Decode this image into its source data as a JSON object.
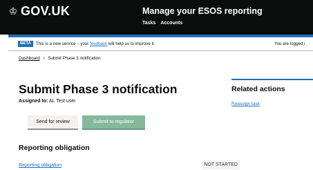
{
  "header": {
    "logo_text": "GOV.UK",
    "logo_icon": "crown-icon",
    "service_name": "Manage your ESOS reporting",
    "nav": [
      {
        "label": "Tasks"
      },
      {
        "label": "Accounts"
      }
    ],
    "colors": {
      "background": "#0b0c0c",
      "accent_bar": "#1d70b8"
    }
  },
  "phase_banner": {
    "tag": "BETA",
    "text_before": "This is a new service – your ",
    "link": "feedback",
    "text_after": " will help us to improve it.",
    "logged_in": "You are logged i"
  },
  "breadcrumb": {
    "items": [
      "Dashboard"
    ],
    "current": "Submit Phase 3 notification",
    "separator_icon": "chevron-right-icon"
  },
  "main": {
    "title": "Submit Phase 3 notification",
    "assigned_label": "Assigned to:",
    "assigned_value": "AL Test user",
    "buttons": {
      "secondary": "Send for review",
      "primary": "Submit to regulator"
    },
    "section_heading": "Reporting obligation",
    "tasks": [
      {
        "label": "Reporting obligation",
        "status": "NOT STARTED"
      }
    ]
  },
  "related": {
    "title": "Related actions",
    "links": [
      "Reassign task"
    ]
  },
  "colors": {
    "link": "#1d70b8",
    "primary_button": "#86b89b",
    "secondary_button": "#f3f2f1",
    "status_tag": "#f3f2f1"
  }
}
